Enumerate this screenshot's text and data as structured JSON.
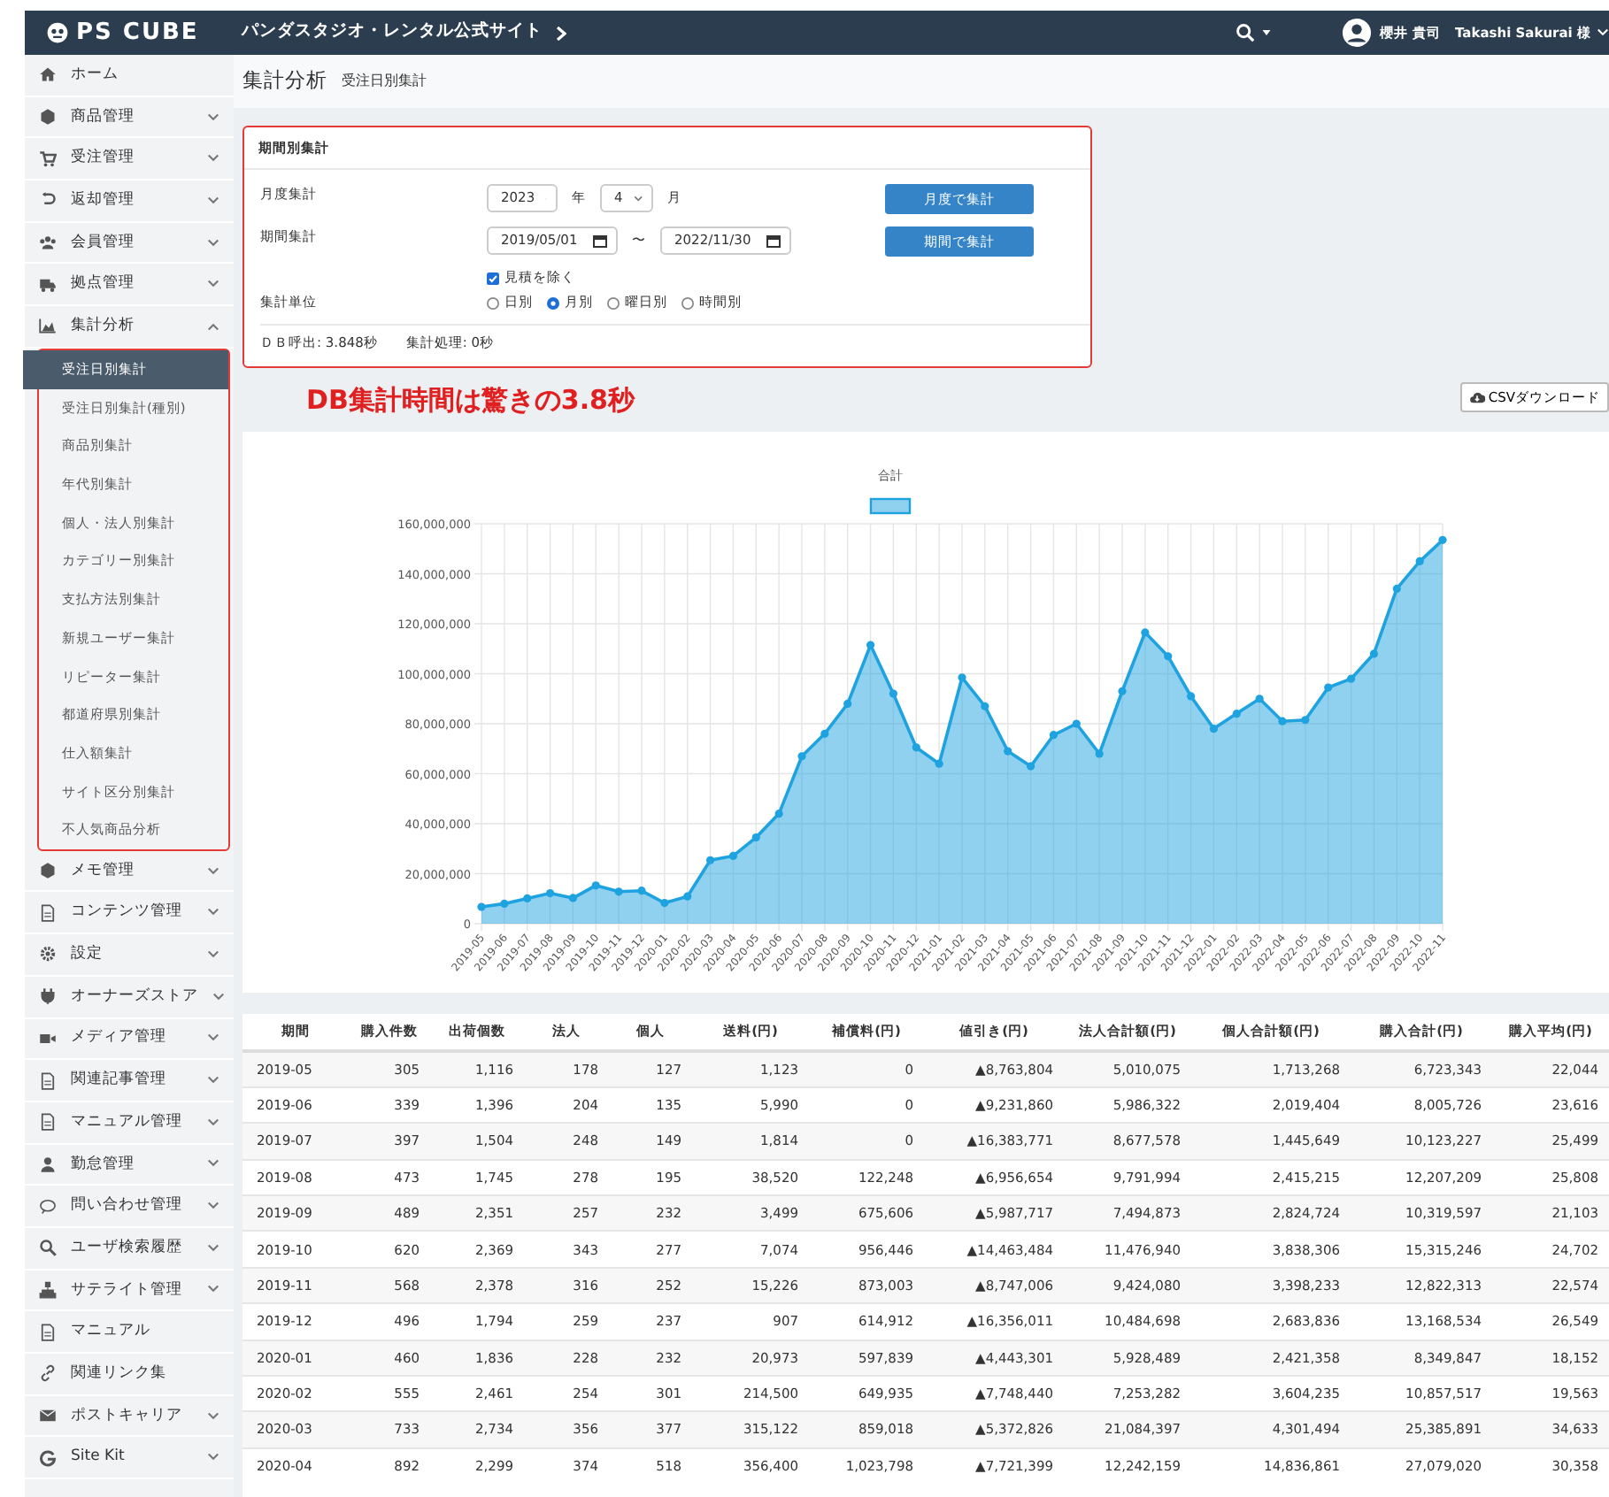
{
  "navbar": {
    "logo": "PS CUBE",
    "site": "パンダスタジオ・レンタル公式サイト",
    "user_name": "櫻井 貴司",
    "user_name_en": "Takashi Sakurai 様"
  },
  "sidebar": {
    "items": [
      {
        "label": "ホーム",
        "kind": "link"
      },
      {
        "label": "商品管理",
        "kind": "group",
        "expanded": false
      },
      {
        "label": "受注管理",
        "kind": "group",
        "expanded": false
      },
      {
        "label": "返却管理",
        "kind": "group",
        "expanded": false
      },
      {
        "label": "会員管理",
        "kind": "group",
        "expanded": false
      },
      {
        "label": "拠点管理",
        "kind": "group",
        "expanded": false
      },
      {
        "label": "集計分析",
        "kind": "group",
        "expanded": true,
        "children": [
          {
            "label": "受注日別集計",
            "selected": true
          },
          {
            "label": "受注日別集計(種別)",
            "selected": false
          },
          {
            "label": "商品別集計",
            "selected": false
          },
          {
            "label": "年代別集計",
            "selected": false
          },
          {
            "label": "個人・法人別集計",
            "selected": false
          },
          {
            "label": "カテゴリー別集計",
            "selected": false
          },
          {
            "label": "支払方法別集計",
            "selected": false
          },
          {
            "label": "新規ユーザー集計",
            "selected": false
          },
          {
            "label": "リピーター集計",
            "selected": false
          },
          {
            "label": "都道府県別集計",
            "selected": false
          },
          {
            "label": "仕入額集計",
            "selected": false
          },
          {
            "label": "サイト区分別集計",
            "selected": false
          },
          {
            "label": "不人気商品分析",
            "selected": false
          }
        ]
      },
      {
        "label": "メモ管理",
        "kind": "group",
        "expanded": false
      },
      {
        "label": "コンテンツ管理",
        "kind": "group",
        "expanded": false
      },
      {
        "label": "設定",
        "kind": "group",
        "expanded": false
      },
      {
        "label": "オーナーズストア",
        "kind": "group",
        "expanded": false
      },
      {
        "label": "メディア管理",
        "kind": "group",
        "expanded": false
      },
      {
        "label": "関連記事管理",
        "kind": "group",
        "expanded": false
      },
      {
        "label": "マニュアル管理",
        "kind": "group",
        "expanded": false
      },
      {
        "label": "勤怠管理",
        "kind": "group",
        "expanded": false
      },
      {
        "label": "問い合わせ管理",
        "kind": "group",
        "expanded": false
      },
      {
        "label": "ユーザ検索履歴",
        "kind": "group",
        "expanded": false
      },
      {
        "label": "サテライト管理",
        "kind": "group",
        "expanded": false
      },
      {
        "label": "マニュアル",
        "kind": "link"
      },
      {
        "label": "関連リンク集",
        "kind": "link"
      },
      {
        "label": "ポストキャリア",
        "kind": "group",
        "expanded": false
      },
      {
        "label": "Site Kit",
        "kind": "group",
        "expanded": false
      }
    ]
  },
  "page_header": {
    "title": "集計分析",
    "subtitle": "受注日別集計"
  },
  "form": {
    "title": "期間別集計",
    "monthly": {
      "label": "月度集計",
      "year": "2023",
      "year_unit": "年",
      "month": "4",
      "month_unit": "月",
      "button": "月度で集計"
    },
    "period": {
      "label": "期間集計",
      "from": "2019/05/01",
      "separator": "〜",
      "to": "2022/11/30",
      "button": "期間で集計"
    },
    "exclude": {
      "label": "見積を除く",
      "checked": true
    },
    "unit": {
      "label": "集計単位",
      "options": [
        {
          "label": "日別",
          "selected": false
        },
        {
          "label": "月別",
          "selected": true
        },
        {
          "label": "曜日別",
          "selected": false
        },
        {
          "label": "時間別",
          "selected": false
        }
      ]
    },
    "footer": [
      "ＤＢ呼出: 3.848秒",
      "集計処理: 0秒"
    ]
  },
  "annotation": "DB集計時間は驚きの3.8秒",
  "csv_button": "CSVダウンロード",
  "chart": {
    "chart_data": {
      "type": "area",
      "title": "合計",
      "categories": [
        "2019-05",
        "2019-06",
        "2019-07",
        "2019-08",
        "2019-09",
        "2019-10",
        "2019-11",
        "2019-12",
        "2020-01",
        "2020-02",
        "2020-03",
        "2020-04",
        "2020-05",
        "2020-06",
        "2020-07",
        "2020-08",
        "2020-09",
        "2020-10",
        "2020-11",
        "2020-12",
        "2021-01",
        "2021-02",
        "2021-03",
        "2021-04",
        "2021-05",
        "2021-06",
        "2021-07",
        "2021-08",
        "2021-09",
        "2021-10",
        "2021-11",
        "2021-12",
        "2022-01",
        "2022-02",
        "2022-03",
        "2022-04",
        "2022-05",
        "2022-06",
        "2022-07",
        "2022-08",
        "2022-09",
        "2022-10",
        "2022-11"
      ],
      "grid": true,
      "series": [
        {
          "color": "#1fa3e0",
          "values": [
            6700000,
            8000000,
            10100000,
            12200000,
            10300000,
            15300000,
            12800000,
            13200000,
            8300000,
            10900000,
            25400000,
            27100000,
            34500000,
            44000000,
            67000000,
            76000000,
            88000000,
            111500000,
            92000000,
            70500000,
            64000000,
            98500000,
            87000000,
            69000000,
            63000000,
            75500000,
            80000000,
            68000000,
            93000000,
            116500000,
            107000000,
            91000000,
            78000000,
            84000000,
            90000000,
            81000000,
            81500000,
            94500000,
            98000000,
            108000000,
            134000000,
            145000000,
            153500000
          ]
        }
      ],
      "ylim": [
        0,
        160000000
      ],
      "yticks": [
        {
          "value": 0,
          "label": "0"
        },
        {
          "value": 20000000,
          "label": "20,000,000"
        },
        {
          "value": 40000000,
          "label": "40,000,000"
        },
        {
          "value": 60000000,
          "label": "60,000,000"
        },
        {
          "value": 80000000,
          "label": "80,000,000"
        },
        {
          "value": 100000000,
          "label": "100,000,000"
        },
        {
          "value": 120000000,
          "label": "120,000,000"
        },
        {
          "value": 140000000,
          "label": "140,000,000"
        },
        {
          "value": 160000000,
          "label": "160,000,000"
        }
      ]
    }
  },
  "table": {
    "columns": [
      "期間",
      "購入件数",
      "出荷個数",
      "法人",
      "個人",
      "送料(円)",
      "補償料(円)",
      "値引き(円)",
      "法人合計額(円)",
      "個人合計額(円)",
      "購入合計(円)",
      "購入平均(円)"
    ],
    "rows": [
      [
        "2019-05",
        "305",
        "1,116",
        "178",
        "127",
        "1,123",
        "0",
        "▲8,763,804",
        "5,010,075",
        "1,713,268",
        "6,723,343",
        "22,044"
      ],
      [
        "2019-06",
        "339",
        "1,396",
        "204",
        "135",
        "5,990",
        "0",
        "▲9,231,860",
        "5,986,322",
        "2,019,404",
        "8,005,726",
        "23,616"
      ],
      [
        "2019-07",
        "397",
        "1,504",
        "248",
        "149",
        "1,814",
        "0",
        "▲16,383,771",
        "8,677,578",
        "1,445,649",
        "10,123,227",
        "25,499"
      ],
      [
        "2019-08",
        "473",
        "1,745",
        "278",
        "195",
        "38,520",
        "122,248",
        "▲6,956,654",
        "9,791,994",
        "2,415,215",
        "12,207,209",
        "25,808"
      ],
      [
        "2019-09",
        "489",
        "2,351",
        "257",
        "232",
        "3,499",
        "675,606",
        "▲5,987,717",
        "7,494,873",
        "2,824,724",
        "10,319,597",
        "21,103"
      ],
      [
        "2019-10",
        "620",
        "2,369",
        "343",
        "277",
        "7,074",
        "956,446",
        "▲14,463,484",
        "11,476,940",
        "3,838,306",
        "15,315,246",
        "24,702"
      ],
      [
        "2019-11",
        "568",
        "2,378",
        "316",
        "252",
        "15,226",
        "873,003",
        "▲8,747,006",
        "9,424,080",
        "3,398,233",
        "12,822,313",
        "22,574"
      ],
      [
        "2019-12",
        "496",
        "1,794",
        "259",
        "237",
        "907",
        "614,912",
        "▲16,356,011",
        "10,484,698",
        "2,683,836",
        "13,168,534",
        "26,549"
      ],
      [
        "2020-01",
        "460",
        "1,836",
        "228",
        "232",
        "20,973",
        "597,839",
        "▲4,443,301",
        "5,928,489",
        "2,421,358",
        "8,349,847",
        "18,152"
      ],
      [
        "2020-02",
        "555",
        "2,461",
        "254",
        "301",
        "214,500",
        "649,935",
        "▲7,748,440",
        "7,253,282",
        "3,604,235",
        "10,857,517",
        "19,563"
      ],
      [
        "2020-03",
        "733",
        "2,734",
        "356",
        "377",
        "315,122",
        "859,018",
        "▲5,372,826",
        "21,084,397",
        "4,301,494",
        "25,385,891",
        "34,633"
      ],
      [
        "2020-04",
        "892",
        "2,299",
        "374",
        "518",
        "356,400",
        "1,023,798",
        "▲7,721,399",
        "12,242,159",
        "14,836,861",
        "27,079,020",
        "30,358"
      ]
    ]
  }
}
